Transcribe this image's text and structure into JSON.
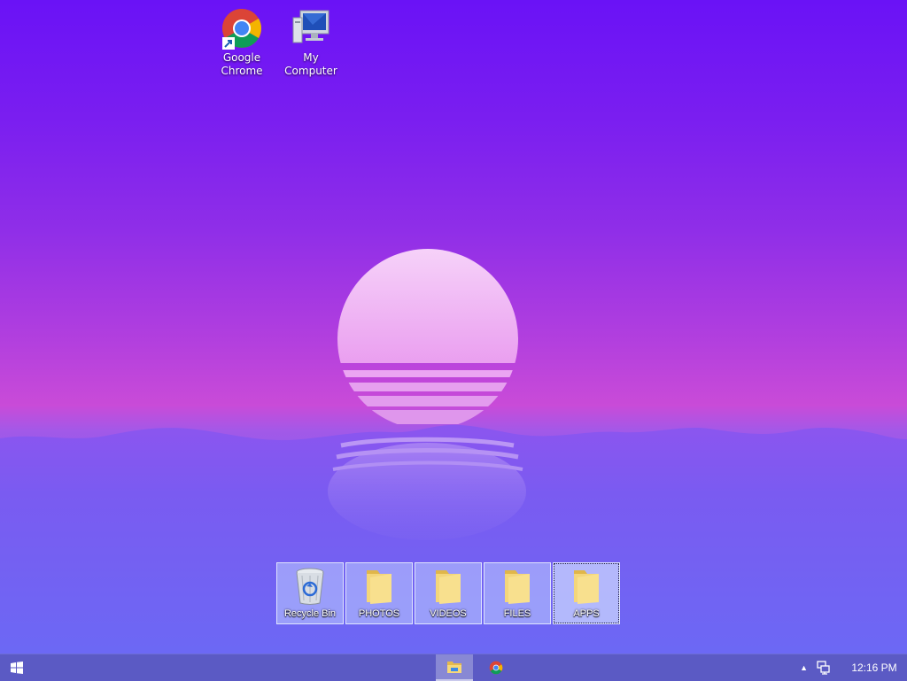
{
  "desktop_icons": [
    {
      "label": "Google\nChrome",
      "icon": "chrome-icon"
    },
    {
      "label": "My Computer",
      "icon": "computer-icon"
    }
  ],
  "dock": {
    "items": [
      {
        "label": "Recycle Bin",
        "icon": "recycle-bin-icon"
      },
      {
        "label": "PHOTOS",
        "icon": "folder-icon"
      },
      {
        "label": "VIDEOS",
        "icon": "folder-icon"
      },
      {
        "label": "FILES",
        "icon": "folder-icon"
      },
      {
        "label": "APPS",
        "icon": "folder-icon",
        "selected": true
      }
    ]
  },
  "taskbar": {
    "start_icon": "windows-logo-icon",
    "apps": [
      {
        "name": "File Explorer",
        "icon": "file-explorer-icon",
        "active": true
      },
      {
        "name": "Google Chrome",
        "icon": "chrome-icon",
        "active": false
      }
    ],
    "tray": {
      "clock": "12:16 PM",
      "icons": [
        "show-hidden-icons-chevron",
        "network-icon"
      ]
    }
  },
  "colors": {
    "sky_top": "#6a12f6",
    "sky_mid": "#c94bd8",
    "sun": "#f2c6f7",
    "mountains": "#7a4ff0",
    "taskbar": "#5b5ac4"
  }
}
